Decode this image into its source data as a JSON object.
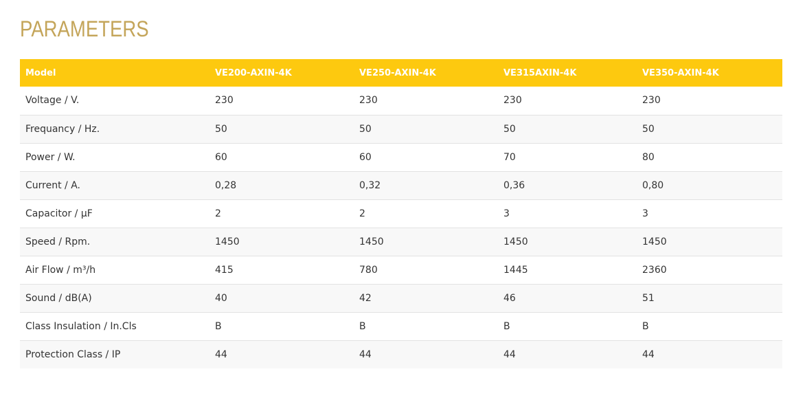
{
  "page": {
    "title": "PARAMETERS"
  },
  "colors": {
    "title": "#c4a55a",
    "header_bg": "#fdc90f",
    "header_text": "#ffffff",
    "row_alt_bg": "#f8f8f8"
  },
  "table": {
    "headers": [
      "Model",
      "VE200-AXIN-4K",
      "VE250-AXIN-4K",
      "VE315AXIN-4K",
      "VE350-AXIN-4K"
    ],
    "rows": [
      [
        "Voltage / V.",
        "230",
        "230",
        "230",
        "230"
      ],
      [
        "Frequancy / Hz.",
        "50",
        "50",
        "50",
        "50"
      ],
      [
        "Power / W.",
        "60",
        "60",
        "70",
        "80"
      ],
      [
        "Current / A.",
        "0,28",
        "0,32",
        "0,36",
        "0,80"
      ],
      [
        "Capacitor / µF",
        "2",
        "2",
        "3",
        "3"
      ],
      [
        "Speed / Rpm.",
        "1450",
        "1450",
        "1450",
        "1450"
      ],
      [
        "Air Flow / m³/h",
        "415",
        "780",
        "1445",
        "2360"
      ],
      [
        "Sound / dB(A)",
        "40",
        "42",
        "46",
        "51"
      ],
      [
        "Class Insulation / In.Cls",
        "B",
        "B",
        "B",
        "B"
      ],
      [
        "Protection Class / IP",
        "44",
        "44",
        "44",
        "44"
      ]
    ]
  }
}
